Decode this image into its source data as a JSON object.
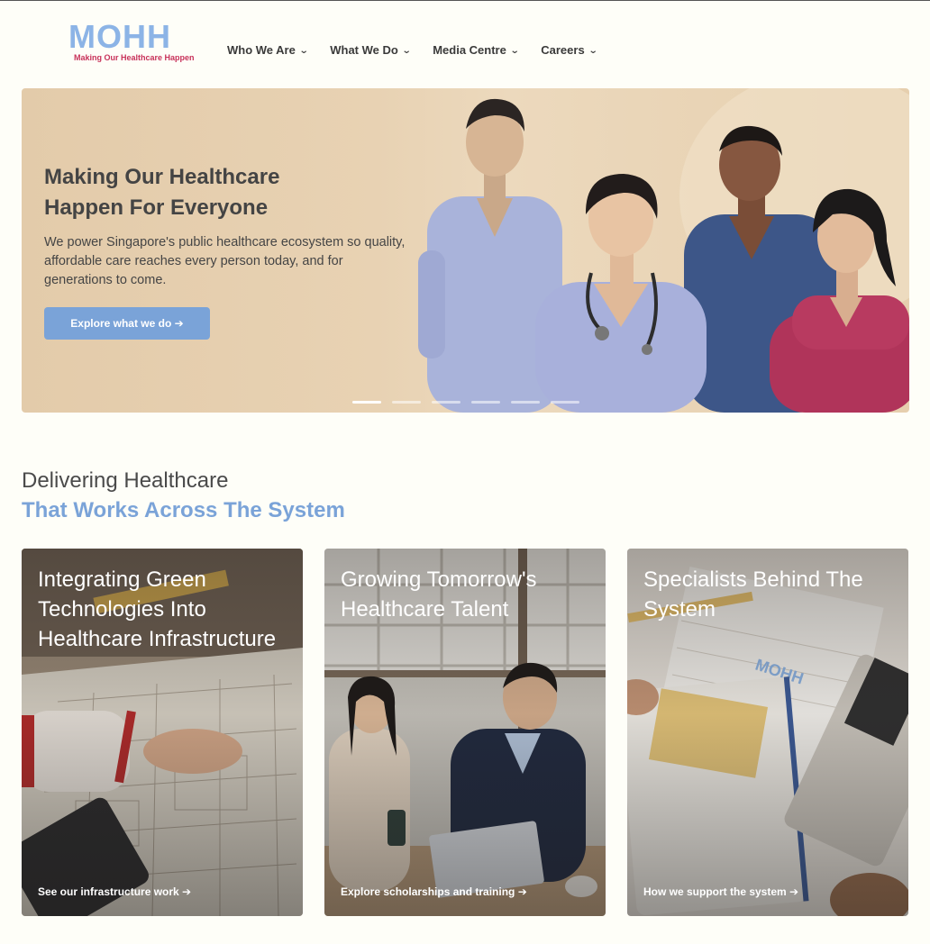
{
  "header": {
    "logo_text": "MOHH",
    "logo_tagline": "Making Our Healthcare Happen",
    "nav": [
      {
        "label": "Who We Are"
      },
      {
        "label": "What We Do"
      },
      {
        "label": "Media Centre"
      },
      {
        "label": "Careers"
      }
    ],
    "chevron": "⌄"
  },
  "hero": {
    "title": "Making Our Healthcare Happen For Everyone",
    "subtitle": "We power Singapore's public healthcare ecosystem so quality, affordable care reaches every person today, and for generations to come.",
    "button_label": "Explore what we do ➔",
    "slide_count": 6,
    "active_slide": 1
  },
  "section": {
    "line1": "Delivering Healthcare",
    "line2": "That Works Across The System"
  },
  "cards": [
    {
      "title": "Integrating Green Technologies Into Healthcare Infrastructure",
      "link": "See our infrastructure work ➔"
    },
    {
      "title": "Growing Tomorrow's Healthcare Talent",
      "link": "Explore scholarships and training ➔"
    },
    {
      "title": "Specialists Behind The System",
      "link": "How we support the system ➔"
    }
  ],
  "colors": {
    "background": "#fefef8",
    "accent_blue": "#7aa3d8",
    "logo_blue": "#8cb4e6",
    "logo_red": "#c8325a",
    "hero_beige": "#e6cfae"
  }
}
